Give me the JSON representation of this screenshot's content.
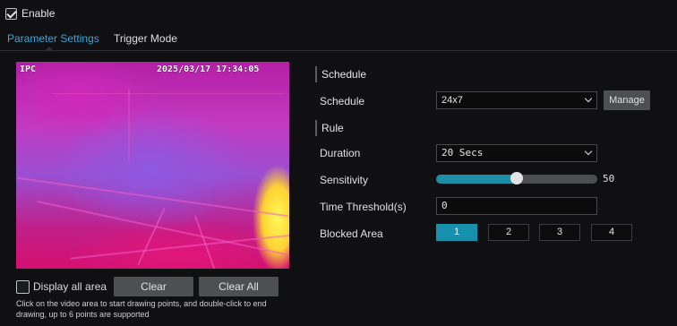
{
  "enable": {
    "label": "Enable",
    "checked": true
  },
  "tabs": [
    {
      "label": "Parameter Settings",
      "active": true
    },
    {
      "label": "Trigger Mode",
      "active": false
    }
  ],
  "video": {
    "channel_label": "IPC",
    "timestamp": "2025/03/17 17:34:05"
  },
  "left_controls": {
    "display_all_label": "Display all area",
    "display_all_checked": false,
    "clear_label": "Clear",
    "clear_all_label": "Clear All",
    "hint": "Click on the video area to start drawing points, and double-click to end drawing, up to 6 points are supported"
  },
  "schedule_section": {
    "title": "Schedule",
    "schedule_label": "Schedule",
    "schedule_value": "24x7",
    "manage_label": "Manage"
  },
  "rule_section": {
    "title": "Rule",
    "duration_label": "Duration",
    "duration_value": "20 Secs",
    "sensitivity_label": "Sensitivity",
    "sensitivity_value": "50",
    "sensitivity_fraction": 0.5,
    "time_threshold_label": "Time Threshold(s)",
    "time_threshold_value": "0",
    "blocked_area_label": "Blocked Area",
    "blocked_areas": [
      "1",
      "2",
      "3",
      "4"
    ],
    "blocked_area_active": "1"
  },
  "colors": {
    "accent": "#35a7d8",
    "active_button": "#1790ad",
    "slider_fill": "#1c8fa6",
    "background": "#101012"
  }
}
